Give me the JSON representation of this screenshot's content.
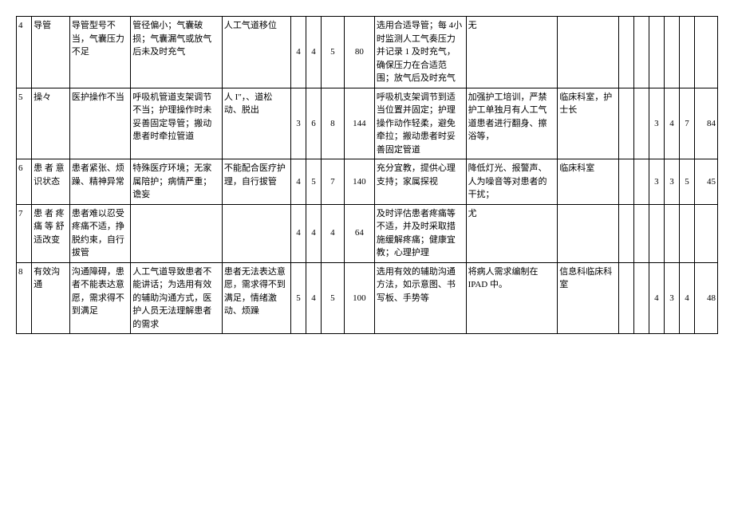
{
  "rows": [
    {
      "num": "4",
      "item": "导管",
      "cause": "导管型号不当，气囊压力不足",
      "mechanism": "管径偏小；气囊破损；气囊漏气或放气后未及时充气",
      "consequence": "人工气道移位",
      "n1": "4",
      "n2": "4",
      "n3": "5",
      "n4": "80",
      "measure": "选用合适导管；每 4小时监测人工气奏压力并记录 1 及时充气，确保压力在合适范围；放气后及时充气",
      "suggest": "无",
      "dept": "",
      "r1": "",
      "r2": "",
      "r3": "",
      "r4": ""
    },
    {
      "num": "5",
      "item": "操々",
      "cause": "医护操作不当",
      "mechanism": "呼吸机管道支架调节不当；护理操作时未妥善固定导管；搬动患者时牵拉管道",
      "consequence": "人 I\"，、道松动、脱出",
      "n1": "3",
      "n2": "6",
      "n3": "8",
      "n4": "144",
      "measure": "呼吸机支架调节到适当位置并固定；护理操作动作轻柔，避免牵拉；搬动患者时妥善固定管道",
      "suggest": "加强护工培训，严禁护工单独月有人工气道患者进行翻身、擦浴等，",
      "dept": "临床科室，护士长",
      "r1": "3",
      "r2": "4",
      "r3": "7",
      "r4": "84"
    },
    {
      "num": "6",
      "item": "患 者 意识状态",
      "cause": "患者紧张、烦躁、精神异常",
      "mechanism": "特殊医疗环境；无家属陪护；病情严重；谵妄",
      "consequence": "不能配合医疗护理，自行拔管",
      "n1": "4",
      "n2": "5",
      "n3": "7",
      "n4": "140",
      "measure": "充分宜教，提供心理支持；家属探视",
      "suggest": "降低灯光、报警声、人为噪音等对患者的干扰；",
      "dept": "临床科室",
      "r1": "3",
      "r2": "3",
      "r3": "5",
      "r4": "45"
    },
    {
      "num": "7",
      "item": "患 者 疼痛 等 舒适改变",
      "cause": "患者难以忍受疼痛不适，挣脱约束，自行拔管",
      "mechanism": "",
      "consequence": "",
      "n1": "4",
      "n2": "4",
      "n3": "4",
      "n4": "64",
      "measure": "及时评估患者疼痛等不适，并及时采取措施缓解疼痛；健康宜教；心理护理",
      "suggest": "尤",
      "dept": "",
      "r1": "",
      "r2": "",
      "r3": "",
      "r4": ""
    },
    {
      "num": "8",
      "item": "有效沟通",
      "cause": "沟通障碍，患者不能表达意愿，需求得不到满足",
      "mechanism": "人工气道导致患者不能讲话；为选用有效的辅助沟通方式，医护人员无法理解患者的需求",
      "consequence": "患者无法表达意愿，需求得不到满足，情绪激动、烦躁",
      "n1": "5",
      "n2": "4",
      "n3": "5",
      "n4": "100",
      "measure": "选用有效的辅助沟通方法，如示意图、书写板、手势等",
      "suggest": "将病人需求编制在IPAD 中。",
      "dept": "信息科临床科室",
      "r1": "4",
      "r2": "3",
      "r3": "4",
      "r4": "48"
    }
  ]
}
